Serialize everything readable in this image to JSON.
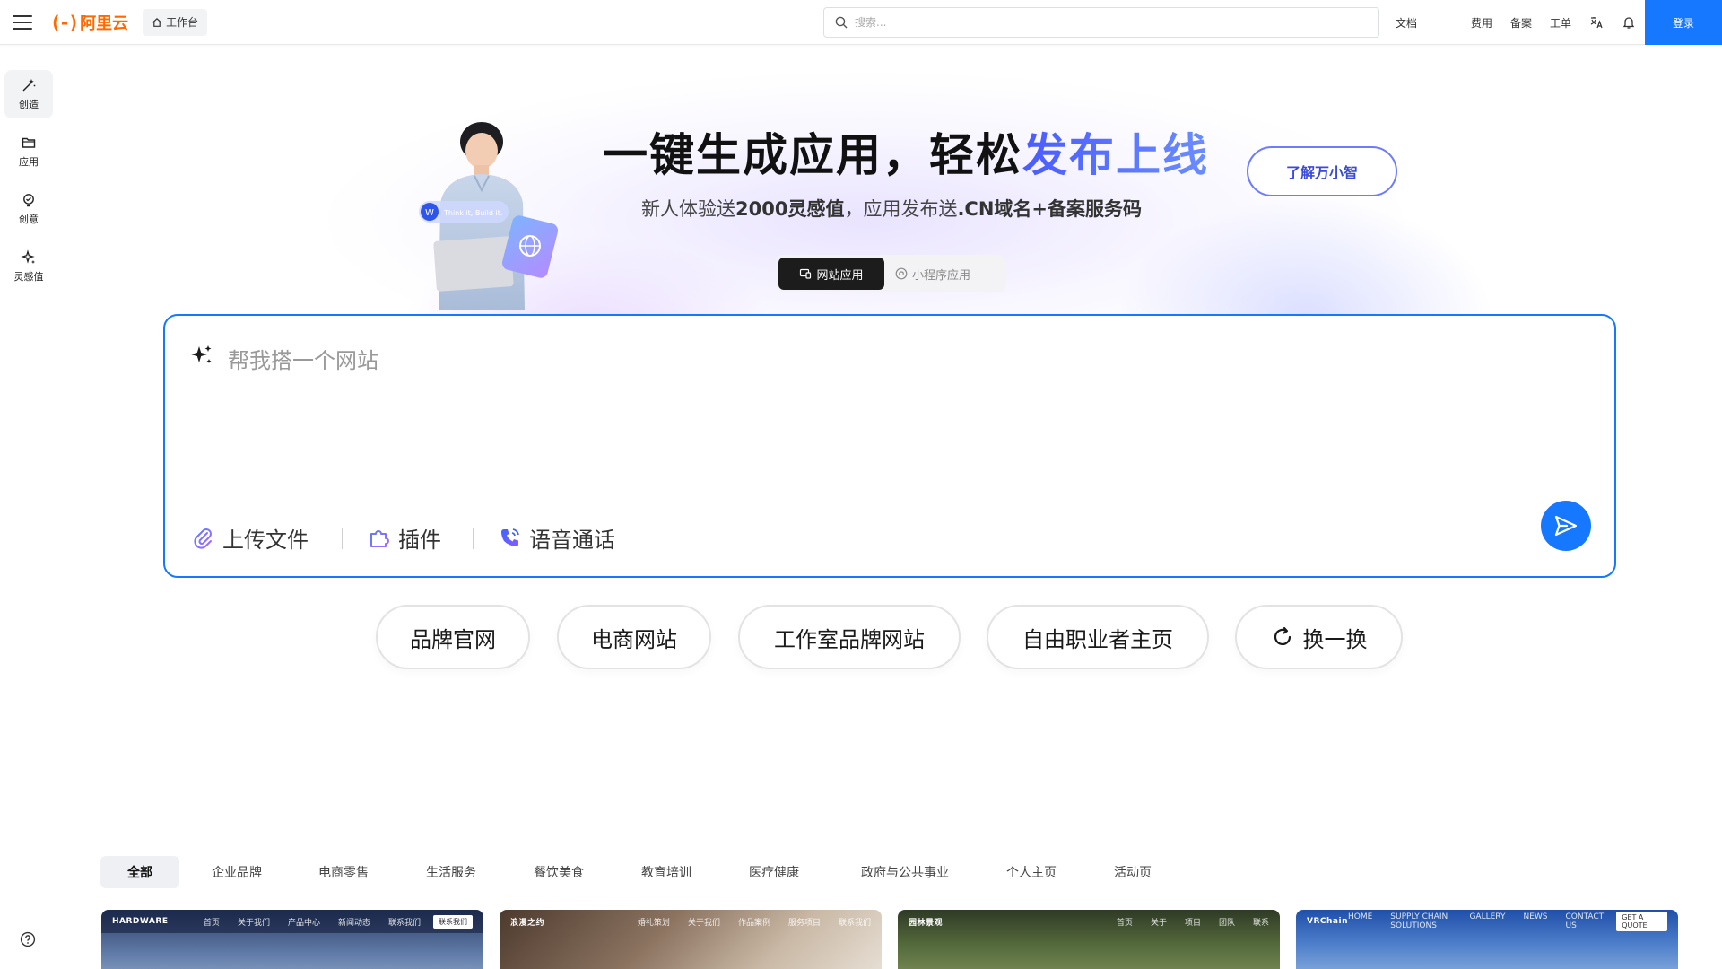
{
  "header": {
    "logo_text": "阿里云",
    "workbench_label": "工作台",
    "search_placeholder": "搜索...",
    "nav": {
      "docs": "文档",
      "billing": "费用",
      "filing": "备案",
      "ticket": "工单"
    },
    "login_label": "登录",
    "accent_color": "#1677ff",
    "brand_color": "#ff6a00"
  },
  "sidebar": {
    "items": [
      {
        "label": "创造",
        "icon": "magic-wand-icon",
        "active": true
      },
      {
        "label": "应用",
        "icon": "folder-icon",
        "active": false
      },
      {
        "label": "创意",
        "icon": "lightbulb-icon",
        "active": false
      },
      {
        "label": "灵感值",
        "icon": "sparkle-icon",
        "active": false
      }
    ],
    "help_icon": "help-circle-icon"
  },
  "hero": {
    "title_plain": "一键生成应用，轻松",
    "title_highlight": "发布上线",
    "subtitle_pre": "新人体验送",
    "subtitle_bold1": "2000灵感值",
    "subtitle_mid": "，应用发布送",
    "subtitle_bold2": ".CN域名+备案服务码",
    "learn_button": "了解万小智",
    "illustration_text": "Think it, Build it."
  },
  "mode_tabs": [
    {
      "label": "网站应用",
      "active": true
    },
    {
      "label": "小程序应用",
      "active": false
    }
  ],
  "prompt": {
    "placeholder": "帮我搭一个网站",
    "tools": {
      "upload": "上传文件",
      "plugin": "插件",
      "voice": "语音通话"
    }
  },
  "suggestions": [
    "品牌官网",
    "电商网站",
    "工作室品牌网站",
    "自由职业者主页"
  ],
  "refresh_label": "换一换",
  "categories": [
    "全部",
    "企业品牌",
    "电商零售",
    "生活服务",
    "餐饮美食",
    "教育培训",
    "医疗健康",
    "政府与公共事业",
    "个人主页",
    "活动页"
  ],
  "templates": [
    {
      "brand": "HARDWARE",
      "links": [
        "首页",
        "关于我们",
        "产品中心",
        "新闻动态",
        "联系我们"
      ],
      "button": "联系我们"
    },
    {
      "brand": "浪漫之约",
      "links": [
        "婚礼策划",
        "关于我们",
        "作品案例",
        "服务项目",
        "联系我们"
      ],
      "button": ""
    },
    {
      "brand": "园林景观",
      "links": [
        "首页",
        "关于",
        "项目",
        "团队",
        "联系"
      ],
      "button": ""
    },
    {
      "brand": "VRChain",
      "links": [
        "HOME",
        "SUPPLY CHAIN SOLUTIONS",
        "GALLERY",
        "NEWS",
        "CONTACT US"
      ],
      "button": "GET A QUOTE"
    }
  ]
}
